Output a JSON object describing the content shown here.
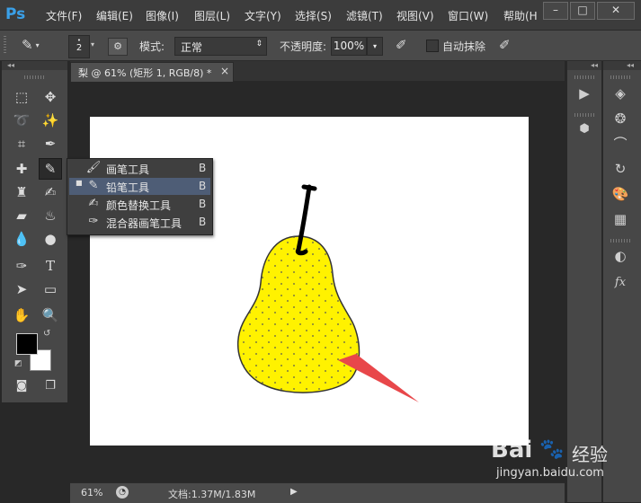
{
  "app_logo": "Ps",
  "menu": [
    "文件(F)",
    "编辑(E)",
    "图像(I)",
    "图层(L)",
    "文字(Y)",
    "选择(S)",
    "滤镜(T)",
    "视图(V)",
    "窗口(W)",
    "帮助(H"
  ],
  "window_controls": {
    "minimize": "–",
    "restore": "□",
    "close": "✕"
  },
  "options": {
    "brush_size": "2",
    "mode_label": "模式:",
    "mode_value": "正常",
    "opacity_label": "不透明度:",
    "opacity_value": "100%",
    "auto_erase_label": "自动抹除"
  },
  "panel_collapse": "◂◂",
  "document": {
    "tab_title": "梨 @ 61% (矩形 1, RGB/8) *",
    "close": "×"
  },
  "status": {
    "zoom": "61%",
    "doc_info": "文档:1.37M/1.83M",
    "arrow": "▶"
  },
  "flyout": [
    {
      "label": "画笔工具",
      "key": "B",
      "icon": "brush-icon",
      "selected": false
    },
    {
      "label": "铅笔工具",
      "key": "B",
      "icon": "pencil-icon",
      "selected": true
    },
    {
      "label": "颜色替换工具",
      "key": "B",
      "icon": "color-replacement-icon",
      "selected": false
    },
    {
      "label": "混合器画笔工具",
      "key": "B",
      "icon": "mixer-brush-icon",
      "selected": false
    }
  ],
  "colors": {
    "foreground": "#000000",
    "background": "#ffffff",
    "pear_fill": "#fff200",
    "arrow": "#e8474a"
  },
  "watermark": {
    "brand": "Bai",
    "brand2": "经验",
    "url": "jingyan.baidu.com"
  }
}
